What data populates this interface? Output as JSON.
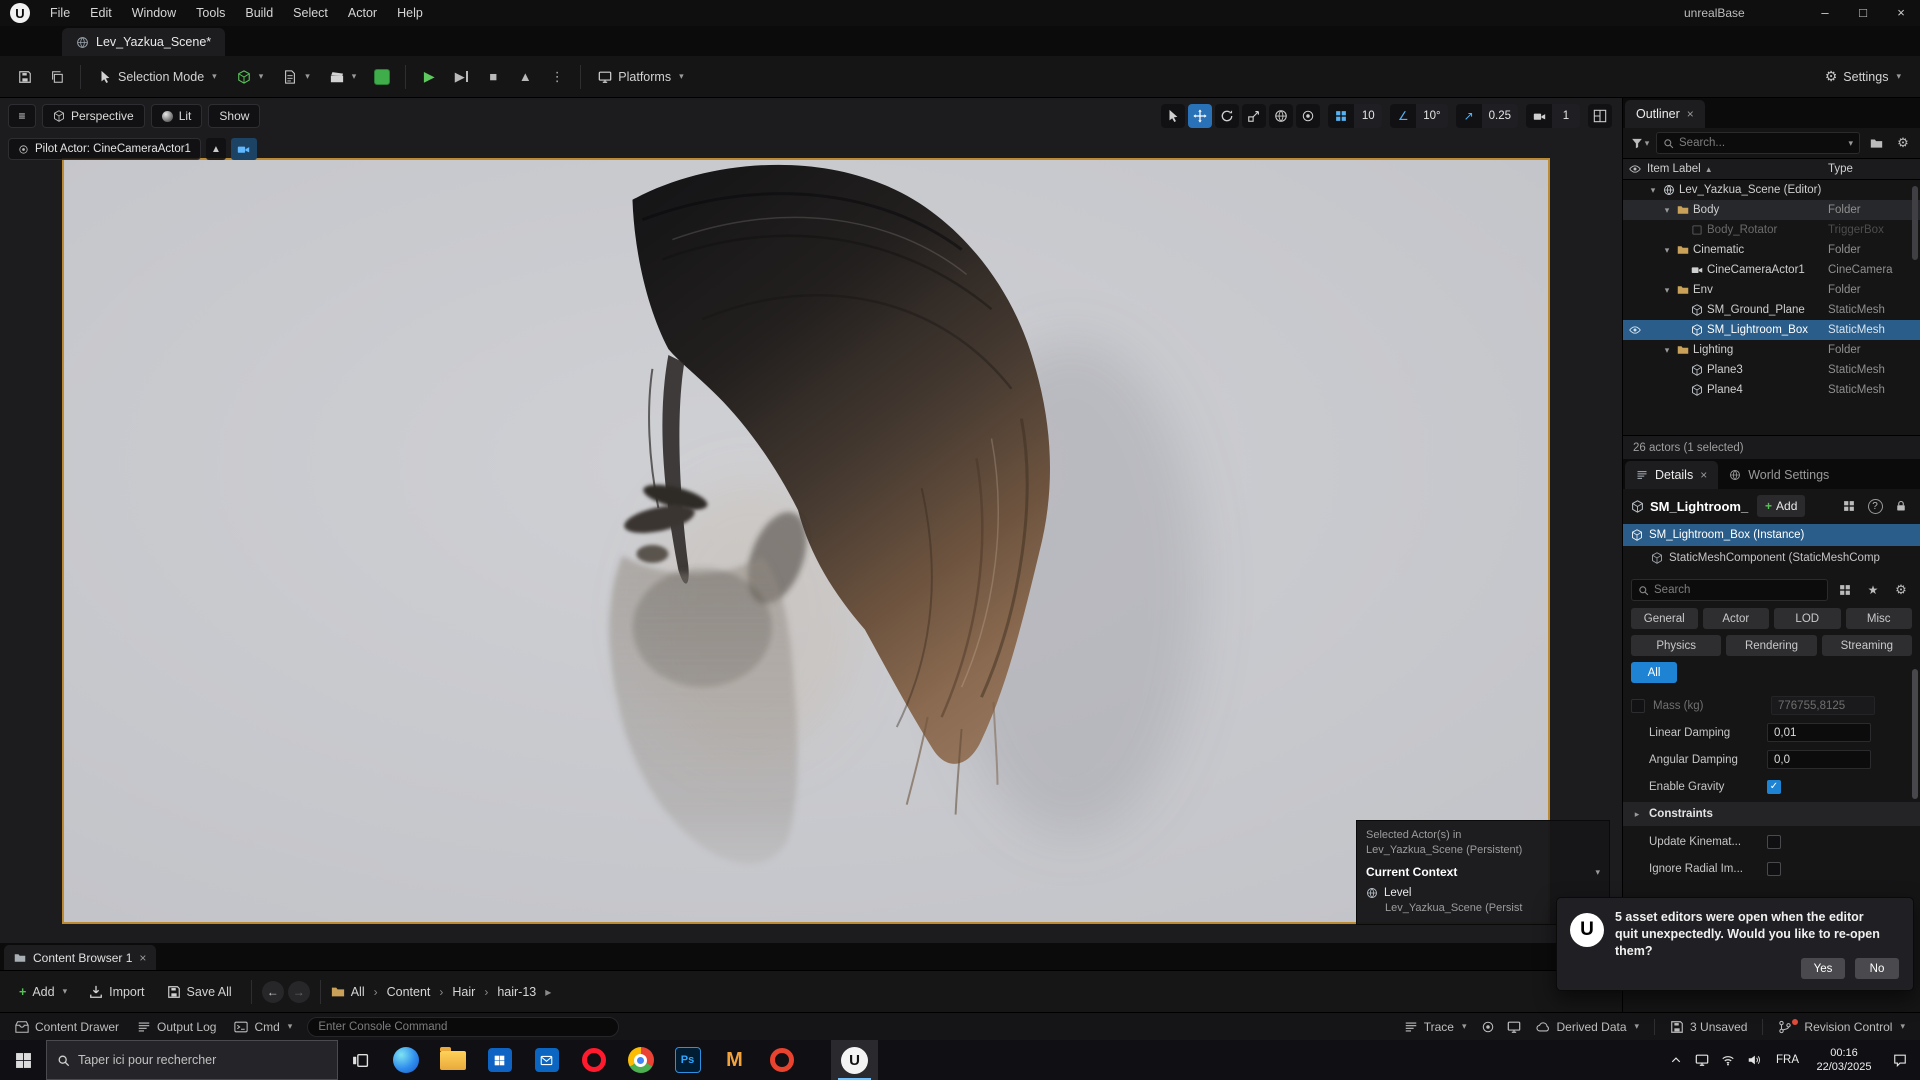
{
  "colors": {
    "accent_blue": "#1f83d3",
    "selection_blue": "#2a5d8a",
    "viewport_frame_orange": "#bc8a33",
    "play_green": "#5ec95e",
    "add_green": "#58c158",
    "folder_gold": "#c9a158"
  },
  "icons": {
    "chevron_down": "▾",
    "chevron_right": "›",
    "caret_right": "▸",
    "sort_up": "▲",
    "hamburger": "≡",
    "kebab": "⋮",
    "close": "×",
    "minimize": "–",
    "maximize": "□",
    "play": "▶",
    "stop": "■",
    "eject": "▲",
    "gear": "⚙",
    "angle": "∠",
    "diag_arrow": "↗",
    "check": "✓",
    "star": "★",
    "back": "←",
    "forward": "→",
    "plus": "+",
    "question": "?"
  },
  "menu_bar": {
    "items": [
      "File",
      "Edit",
      "Window",
      "Tools",
      "Build",
      "Select",
      "Actor",
      "Help"
    ],
    "project": "unrealBase",
    "logo": "U",
    "window": {
      "minimize": "–",
      "maximize": "□",
      "close": "×"
    }
  },
  "tabs": {
    "asset_tab": "Lev_Yazkua_Scene*"
  },
  "toolbar": {
    "selection_mode": "Selection Mode",
    "platforms": "Platforms",
    "settings": "Settings"
  },
  "viewport": {
    "perspective": "Perspective",
    "lit": "Lit",
    "show": "Show",
    "pilot_label": "Pilot Actor: CineCameraActor1",
    "snap_grid": "10",
    "snap_angle": "10°",
    "snap_scale": "0.25",
    "camera_speed": "1"
  },
  "outliner": {
    "title": "Outliner",
    "search_placeholder": "Search...",
    "col_label": "Item Label",
    "col_type": "Type",
    "rows": [
      {
        "label": "Lev_Yazkua_Scene (Editor)",
        "type": ""
      },
      {
        "label": "Body",
        "type": "Folder"
      },
      {
        "label": "Body_Rotator",
        "type": "TriggerBox"
      },
      {
        "label": "Cinematic",
        "type": "Folder"
      },
      {
        "label": "CineCameraActor1",
        "type": "CineCamera"
      },
      {
        "label": "Env",
        "type": "Folder"
      },
      {
        "label": "SM_Ground_Plane",
        "type": "StaticMesh"
      },
      {
        "label": "SM_Lightroom_Box",
        "type": "StaticMesh"
      },
      {
        "label": "Lighting",
        "type": "Folder"
      },
      {
        "label": "Plane3",
        "type": "StaticMesh"
      },
      {
        "label": "Plane4",
        "type": "StaticMesh"
      }
    ],
    "status": "26 actors (1 selected)"
  },
  "details": {
    "tab_details": "Details",
    "tab_world": "World Settings",
    "header_name": "SM_Lightroom_Box",
    "add_label": "Add",
    "instance_label": "SM_Lightroom_Box (Instance)",
    "component_label": "StaticMeshComponent (StaticMeshComp",
    "search_placeholder": "Search",
    "filters": [
      "General",
      "Actor",
      "LOD",
      "Misc",
      "Physics",
      "Rendering",
      "Streaming"
    ],
    "filter_all": "All",
    "prop_mass_label": "Mass (kg)",
    "prop_mass_value": "776755,8125",
    "prop_linear_label": "Linear Damping",
    "prop_linear_value": "0,01",
    "prop_angular_label": "Angular Damping",
    "prop_angular_value": "0,0",
    "prop_gravity_label": "Enable Gravity",
    "prop_constraints_label": "Constraints",
    "prop_kinematic_label": "Update Kinemat...",
    "prop_radial_label": "Ignore Radial Im..."
  },
  "context_overlay": {
    "line1": "Selected Actor(s) in",
    "line2": "Lev_Yazkua_Scene (Persistent)",
    "heading": "Current Context",
    "level_label": "Level",
    "level_value": "Lev_Yazkua_Scene (Persist"
  },
  "toast": {
    "message": "5 asset editors were open when the editor quit unexpectedly. Would you like to re-open them?",
    "yes": "Yes",
    "no": "No"
  },
  "content_browser": {
    "tab": "Content Browser 1",
    "add": "Add",
    "import": "Import",
    "save_all": "Save All",
    "crumbs": [
      "All",
      "Content",
      "Hair",
      "hair-13"
    ]
  },
  "status_bar": {
    "content_drawer": "Content Drawer",
    "output_log": "Output Log",
    "cmd": "Cmd",
    "console_placeholder": "Enter Console Command",
    "trace": "Trace",
    "derived_data": "Derived Data",
    "unsaved": "3 Unsaved",
    "revision_control": "Revision Control"
  },
  "taskbar": {
    "search_placeholder": "Taper ici pour rechercher",
    "language": "FRA",
    "time": "00:16",
    "date": "22/03/2025",
    "photoshop_label": "Ps",
    "m_label": "M",
    "unreal_label": "U"
  }
}
